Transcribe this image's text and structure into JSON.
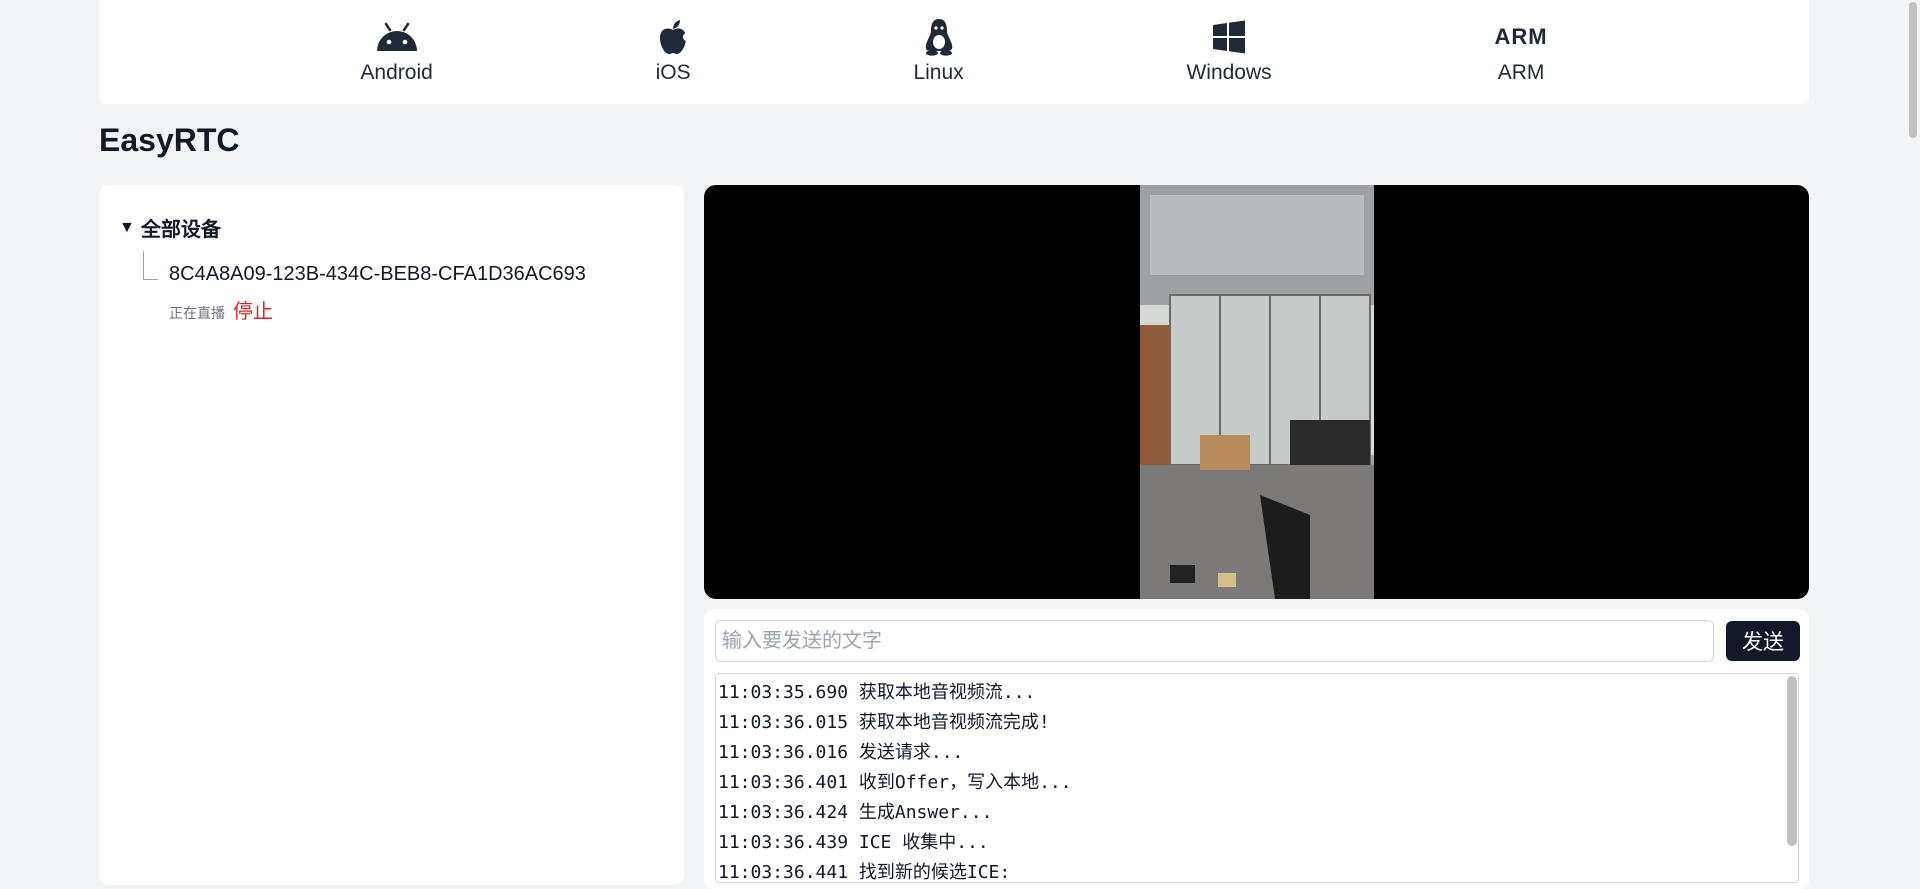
{
  "platforms": [
    {
      "label": "Android",
      "icon": "android-icon"
    },
    {
      "label": "iOS",
      "icon": "apple-icon"
    },
    {
      "label": "Linux",
      "icon": "linux-penguin-icon"
    },
    {
      "label": "Windows",
      "icon": "windows-icon"
    },
    {
      "label": "ARM",
      "icon": "arm-icon",
      "glyph": "ARM"
    }
  ],
  "page": {
    "title": "EasyRTC"
  },
  "devices": {
    "group_label": "全部设备",
    "caret": "▼",
    "items": [
      {
        "id": "8C4A8A09-123B-434C-BEB8-CFA1D36AC693",
        "status": "正在直播",
        "action": "停止"
      }
    ]
  },
  "chat": {
    "placeholder": "输入要发送的文字",
    "value": "",
    "send_label": "发送"
  },
  "log": {
    "lines": [
      "11:03:35.690 获取本地音视频流...",
      "11:03:36.015 获取本地音视频流完成!",
      "11:03:36.016 发送请求...",
      "11:03:36.401 收到Offer，写入本地...",
      "11:03:36.424 生成Answer...",
      "11:03:36.439 ICE 收集中...",
      "11:03:36.441 找到新的候选ICE:"
    ]
  },
  "colors": {
    "background": "#f3f4f6",
    "panel": "#ffffff",
    "stop": "#dc2626",
    "button": "#111827",
    "video_bg": "#000000"
  }
}
